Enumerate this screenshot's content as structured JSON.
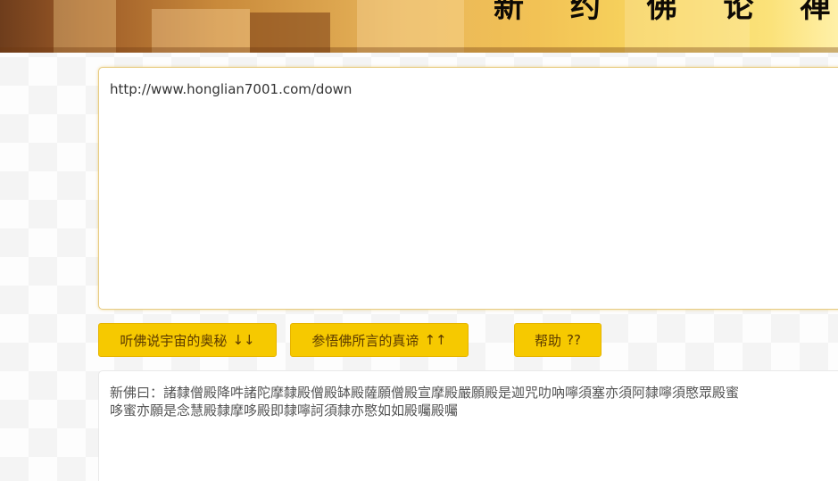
{
  "header": {
    "title": "新 约 佛 论 禅"
  },
  "input": {
    "value": "http://www.honglian7001.com/down"
  },
  "buttons": {
    "decode_label": "听佛说宇宙的奥秘",
    "decode_arrow": "↓↓",
    "encode_label": "参悟佛所言的真谛",
    "encode_arrow": "↑↑",
    "help_label": "帮助",
    "help_suffix": "??"
  },
  "output": {
    "line1": "新佛曰：諸隸僧殿降吽諸陀摩隸殿僧殿缽殿薩願僧殿宣摩殿嚴願殿是迦咒叻吶嚀須塞亦須阿隸嚀須愍眾殿蜜",
    "line2": "哆蜜亦願是念慧殿隸摩哆殿即隸嚀訶須隸亦愍如如殿囑殿囑"
  }
}
